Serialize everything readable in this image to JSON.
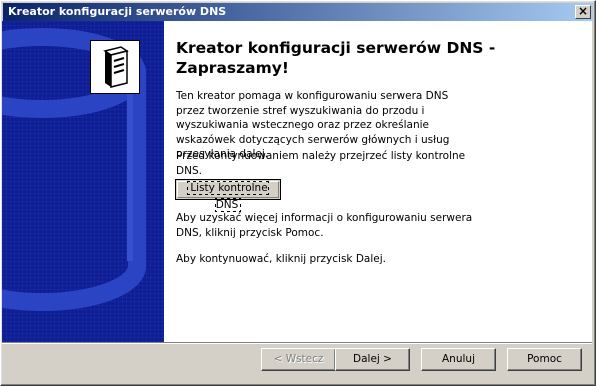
{
  "window": {
    "title": "Kreator konfiguracji serwerów DNS",
    "close_glyph": "×"
  },
  "icons": {
    "wizard_graphic": "database-cylinder-graphic",
    "server": "server-tower-icon"
  },
  "main": {
    "heading": "Kreator konfiguracji serwerów DNS - Zapraszamy!",
    "intro": "Ten kreator pomaga w konfigurowaniu serwera DNS przez tworzenie stref wyszukiwania do przodu i wyszukiwania wstecznego oraz przez określanie wskazówek dotyczących serwerów głównych i usług przesyłania dalej.",
    "checklist_prompt": "Przed kontynuowaniem należy przejrzeć listy kontrolne DNS.",
    "checklist_button": "Listy kontrolne DNS",
    "more_info": "Aby uzyskać więcej informacji o konfigurowaniu serwera DNS, kliknij przycisk Pomoc.",
    "continue": "Aby kontynuować, kliknij przycisk Dalej."
  },
  "buttons": {
    "back": "< Wstecz",
    "next": "Dalej >",
    "cancel": "Anuluj",
    "help": "Pomoc"
  },
  "colors": {
    "title_start": "#0a246a",
    "title_end": "#a6caf0",
    "left_panel": "#0e1e92",
    "face": "#d4d0c8"
  }
}
